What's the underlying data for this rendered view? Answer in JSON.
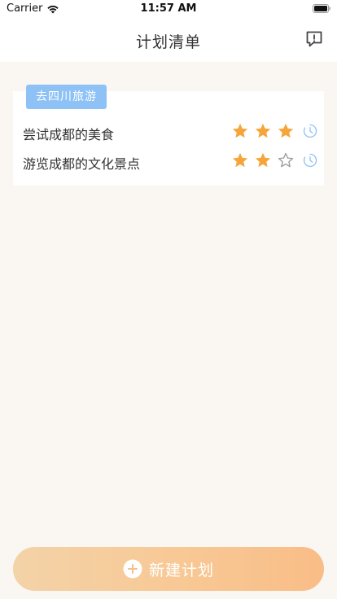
{
  "status_bar": {
    "carrier": "Carrier",
    "time": "11:57 AM"
  },
  "nav": {
    "title": "计划清单",
    "feedback_icon": "feedback-exclamation-icon"
  },
  "plan": {
    "tag": "去四川旅游",
    "items": [
      {
        "text": "尝试成都的美食",
        "rating": 3,
        "max_rating": 3
      },
      {
        "text": "游览成都的文化景点",
        "rating": 2,
        "max_rating": 3
      }
    ]
  },
  "new_plan_button": {
    "label": "新建计划"
  },
  "colors": {
    "background": "#faf6f2",
    "tag": "#8ec2f6",
    "star_filled": "#f5a53a",
    "star_empty": "#999999",
    "clock": "#8ec2f6",
    "button_gradient_start": "#f3d3a8",
    "button_gradient_end": "#f9bd87"
  }
}
